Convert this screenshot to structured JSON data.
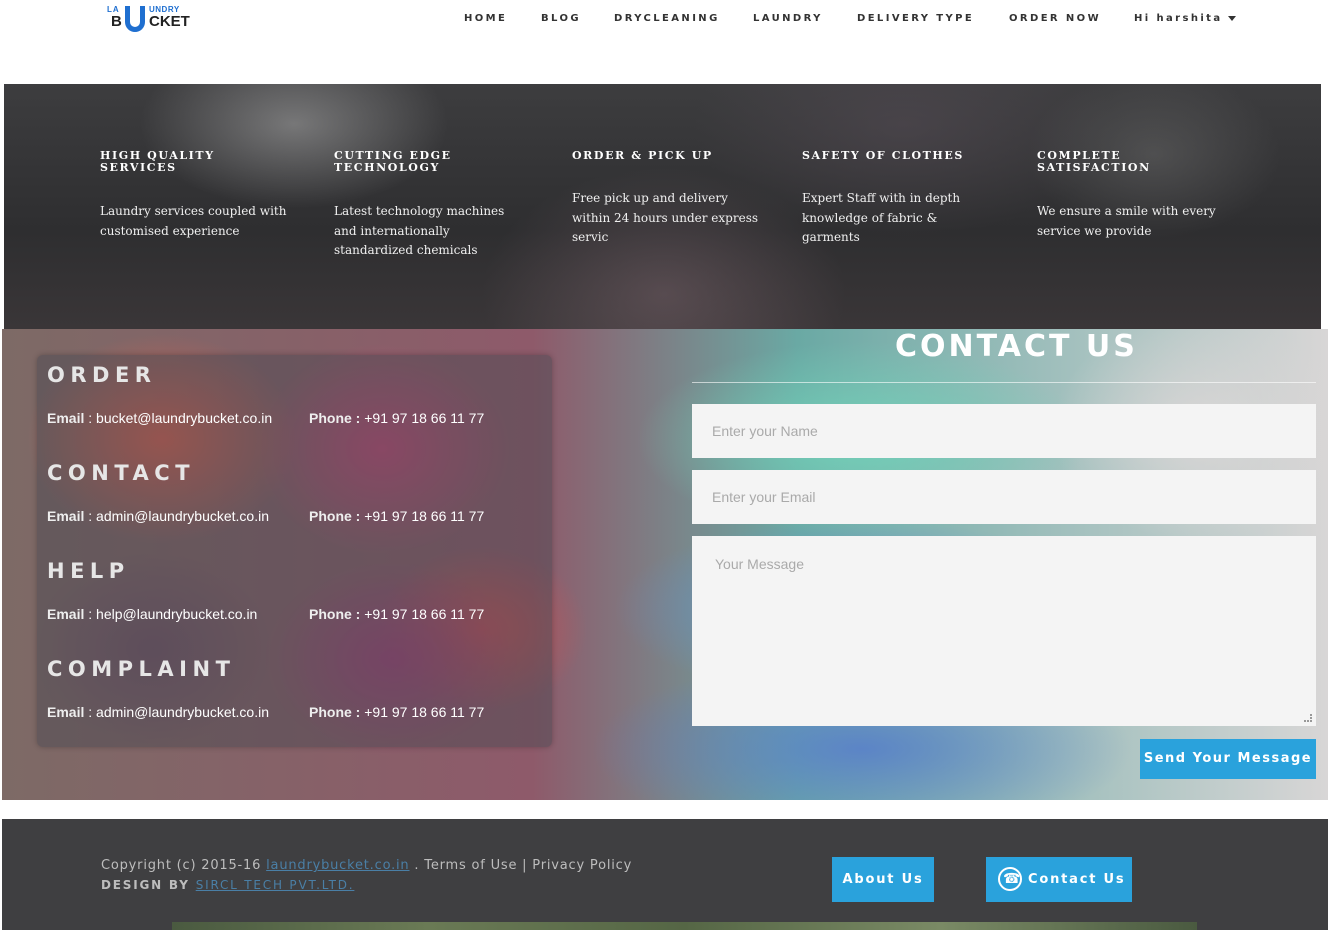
{
  "logo": {
    "top_left": "LA",
    "top_right": "UNDRY",
    "bottom_left": "B",
    "bottom_right": "CKET"
  },
  "nav": {
    "items": [
      "HOME",
      "BLOG",
      "DRYCLEANING",
      "LAUNDRY",
      "DELIVERY TYPE",
      "ORDER NOW"
    ],
    "user": "Hi harshita"
  },
  "features": [
    {
      "title": "HIGH QUALITY SERVICES",
      "text": "Laundry services coupled with customised experience"
    },
    {
      "title": "CUTTING EDGE TECHNOLOGY",
      "text": "Latest technology machines and internationally standardized chemicals"
    },
    {
      "title": "ORDER & PICK UP",
      "text": "Free pick up and delivery within 24 hours under express servic"
    },
    {
      "title": "SAFETY OF CLOTHES",
      "text": "Expert Staff with in depth knowledge of fabric & garments"
    },
    {
      "title": "COMPLETE SATISFACTION",
      "text": "We ensure a smile with every service we provide"
    }
  ],
  "contact": {
    "email_label": "Email",
    "phone_label": "Phone :",
    "blocks": [
      {
        "title": "ORDER",
        "email": "bucket@laundrybucket.co.in",
        "phone": "+91 97 18 66 11 77"
      },
      {
        "title": "CONTACT",
        "email": "admin@laundrybucket.co.in",
        "phone": "+91 97 18 66 11 77"
      },
      {
        "title": "HELP",
        "email": "help@laundrybucket.co.in",
        "phone": "+91 97 18 66 11 77"
      },
      {
        "title": "COMPLAINT",
        "email": "admin@laundrybucket.co.in",
        "phone": "+91 97 18 66 11 77"
      }
    ]
  },
  "form": {
    "title": "CONTACT US",
    "name_placeholder": "Enter your Name",
    "email_placeholder": "Enter your Email",
    "message_placeholder": "Your Message",
    "send_label": "Send Your Message"
  },
  "footer": {
    "copyright_prefix": "Copyright (c) 2015-16",
    "site_link": "laundrybucket.co.in",
    "terms": ". Terms of Use | Privacy Policy",
    "design_prefix": "DESIGN  BY",
    "design_link": "SIRCL TECH PVT.LTD.",
    "about_label": "About Us",
    "contact_label": "Contact Us"
  },
  "colors": {
    "accent": "#2aa2dc",
    "footer_bg": "#3f3f41",
    "logo_blue": "#1f6fd0"
  }
}
